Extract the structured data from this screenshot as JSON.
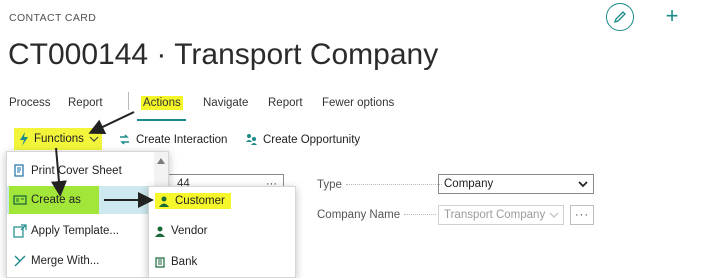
{
  "header": {
    "kicker": "CONTACT CARD",
    "title": "CT000144 · Transport Company",
    "edit_icon": "pencil-icon",
    "new_icon": "plus-icon"
  },
  "menu": {
    "tabs": [
      {
        "label": "Process"
      },
      {
        "label": "Report"
      },
      {
        "label": "Actions",
        "highlighted": true,
        "active": true
      },
      {
        "label": "Navigate"
      },
      {
        "label": "Report"
      },
      {
        "label": "Fewer options"
      }
    ]
  },
  "toolbar": {
    "functions_label": "Functions",
    "create_interaction_label": "Create Interaction",
    "create_opportunity_label": "Create Opportunity"
  },
  "functions_menu": {
    "items": [
      {
        "label": "Print Cover Sheet",
        "icon": "print-sheet-icon"
      },
      {
        "label": "Create as",
        "icon": "create-card-icon",
        "highlighted": true
      },
      {
        "label": "Apply Template...",
        "icon": "template-icon"
      },
      {
        "label": "Merge With...",
        "icon": "merge-icon"
      }
    ]
  },
  "create_as_menu": {
    "items": [
      {
        "label": "Customer",
        "icon": "person-icon",
        "highlighted": true
      },
      {
        "label": "Vendor",
        "icon": "person-icon"
      },
      {
        "label": "Bank",
        "icon": "bank-icon"
      }
    ]
  },
  "form": {
    "partial_value": "44",
    "partial_button": "···",
    "type_label": "Type",
    "type_value": "Company",
    "company_name_label": "Company Name",
    "company_name_value": "Transport Company",
    "company_name_button": "···"
  },
  "colors": {
    "accent": "#1b8a8a",
    "highlight_yellow": "#f4f628",
    "highlight_green": "#a2e63a",
    "hover_blue": "#cde8ee"
  }
}
